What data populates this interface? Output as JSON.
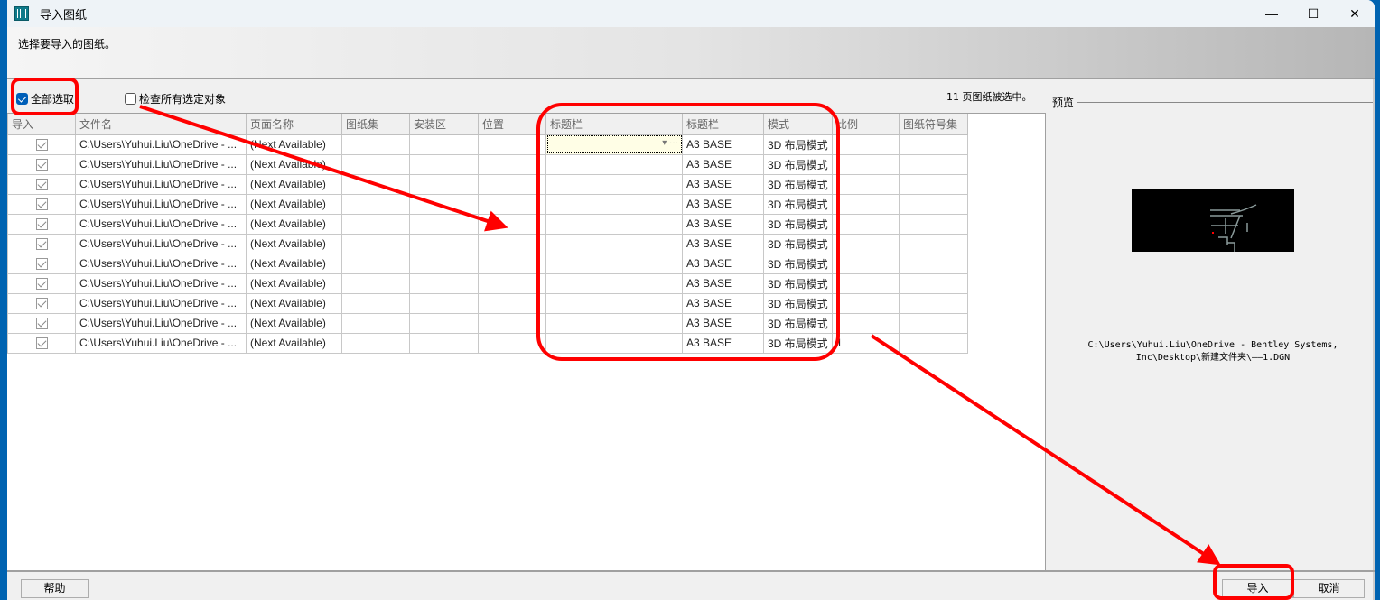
{
  "window": {
    "title": "导入图纸",
    "minimize": "—",
    "maximize": "☐",
    "close": "✕"
  },
  "header": {
    "instruction": "选择要导入的图纸。"
  },
  "options": {
    "select_all": "全部选取",
    "select_all_checked": true,
    "check_all": "检查所有选定对象",
    "check_all_checked": false
  },
  "status": {
    "selected_count": "11 页图纸被选中。"
  },
  "columns": [
    "导入",
    "文件名",
    "页面名称",
    "图纸集",
    "安装区",
    "位置",
    "标题栏",
    "标题栏",
    "模式",
    "比例",
    "图纸符号集"
  ],
  "rows": [
    {
      "import": true,
      "file": "C:\\Users\\Yuhui.Liu\\OneDrive - ...",
      "page": "(Next Available)",
      "sheetset": "",
      "zone": "",
      "location": "",
      "titleblock": "",
      "titleblock2": "A3 BASE",
      "mode": "3D 布局模式",
      "scale": "",
      "symbolset": ""
    },
    {
      "import": true,
      "file": "C:\\Users\\Yuhui.Liu\\OneDrive - ...",
      "page": "(Next Available)",
      "sheetset": "",
      "zone": "",
      "location": "",
      "titleblock": "",
      "titleblock2": "A3 BASE",
      "mode": "3D 布局模式",
      "scale": "",
      "symbolset": ""
    },
    {
      "import": true,
      "file": "C:\\Users\\Yuhui.Liu\\OneDrive - ...",
      "page": "(Next Available)",
      "sheetset": "",
      "zone": "",
      "location": "",
      "titleblock": "",
      "titleblock2": "A3 BASE",
      "mode": "3D 布局模式",
      "scale": "",
      "symbolset": ""
    },
    {
      "import": true,
      "file": "C:\\Users\\Yuhui.Liu\\OneDrive - ...",
      "page": "(Next Available)",
      "sheetset": "",
      "zone": "",
      "location": "",
      "titleblock": "",
      "titleblock2": "A3 BASE",
      "mode": "3D 布局模式",
      "scale": "",
      "symbolset": ""
    },
    {
      "import": true,
      "file": "C:\\Users\\Yuhui.Liu\\OneDrive - ...",
      "page": "(Next Available)",
      "sheetset": "",
      "zone": "",
      "location": "",
      "titleblock": "",
      "titleblock2": "A3 BASE",
      "mode": "3D 布局模式",
      "scale": "",
      "symbolset": ""
    },
    {
      "import": true,
      "file": "C:\\Users\\Yuhui.Liu\\OneDrive - ...",
      "page": "(Next Available)",
      "sheetset": "",
      "zone": "",
      "location": "",
      "titleblock": "",
      "titleblock2": "A3 BASE",
      "mode": "3D 布局模式",
      "scale": "",
      "symbolset": ""
    },
    {
      "import": true,
      "file": "C:\\Users\\Yuhui.Liu\\OneDrive - ...",
      "page": "(Next Available)",
      "sheetset": "",
      "zone": "",
      "location": "",
      "titleblock": "",
      "titleblock2": "A3 BASE",
      "mode": "3D 布局模式",
      "scale": "",
      "symbolset": ""
    },
    {
      "import": true,
      "file": "C:\\Users\\Yuhui.Liu\\OneDrive - ...",
      "page": "(Next Available)",
      "sheetset": "",
      "zone": "",
      "location": "",
      "titleblock": "",
      "titleblock2": "A3 BASE",
      "mode": "3D 布局模式",
      "scale": "",
      "symbolset": ""
    },
    {
      "import": true,
      "file": "C:\\Users\\Yuhui.Liu\\OneDrive - ...",
      "page": "(Next Available)",
      "sheetset": "",
      "zone": "",
      "location": "",
      "titleblock": "",
      "titleblock2": "A3 BASE",
      "mode": "3D 布局模式",
      "scale": "",
      "symbolset": ""
    },
    {
      "import": true,
      "file": "C:\\Users\\Yuhui.Liu\\OneDrive - ...",
      "page": "(Next Available)",
      "sheetset": "",
      "zone": "",
      "location": "",
      "titleblock": "",
      "titleblock2": "A3 BASE",
      "mode": "3D 布局模式",
      "scale": "",
      "symbolset": ""
    },
    {
      "import": true,
      "file": "C:\\Users\\Yuhui.Liu\\OneDrive - ...",
      "page": "(Next Available)",
      "sheetset": "",
      "zone": "",
      "location": "",
      "titleblock": "",
      "titleblock2": "A3 BASE",
      "mode": "3D 布局模式",
      "scale": "1",
      "symbolset": ""
    }
  ],
  "preview": {
    "label": "预览",
    "path_line1": "C:\\Users\\Yuhui.Liu\\OneDrive - Bentley Systems,",
    "path_line2": "Inc\\Desktop\\新建文件夹\\——1.DGN"
  },
  "buttons": {
    "help": "帮助",
    "import": "导入",
    "cancel": "取消"
  },
  "annotation_color": "#ff0000"
}
